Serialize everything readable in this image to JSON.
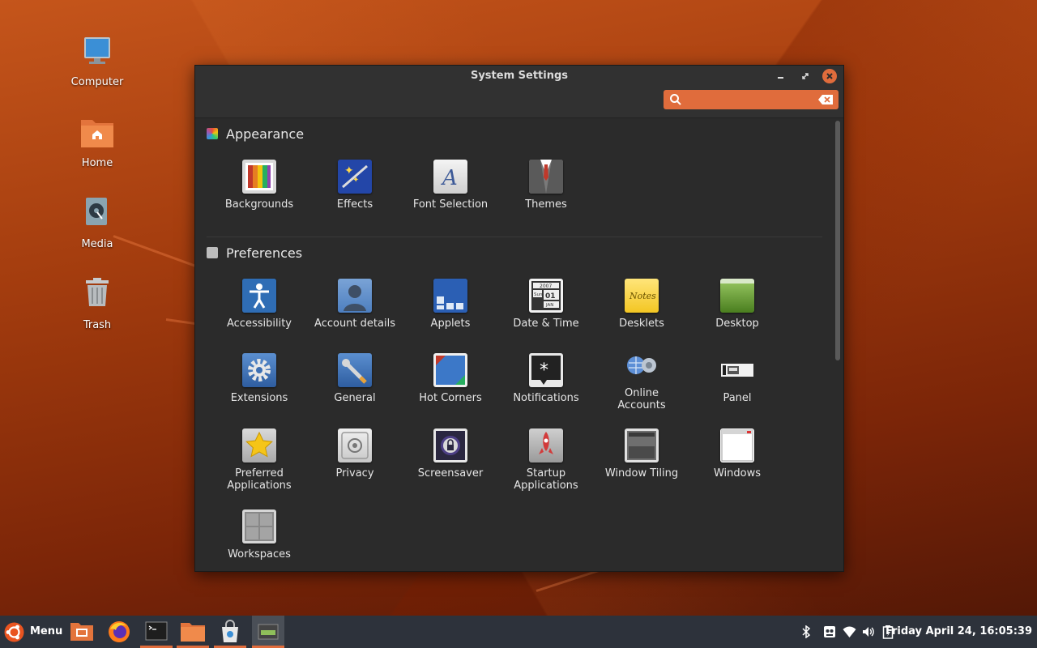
{
  "desktop": {
    "icons": [
      {
        "label": "Computer"
      },
      {
        "label": "Home"
      },
      {
        "label": "Media"
      },
      {
        "label": "Trash"
      }
    ]
  },
  "window": {
    "title": "System Settings",
    "search": {
      "value": "",
      "placeholder": ""
    },
    "sections": [
      {
        "title": "Appearance",
        "items": [
          {
            "label": "Backgrounds",
            "icon": "backgrounds-icon"
          },
          {
            "label": "Effects",
            "icon": "effects-icon"
          },
          {
            "label": "Font Selection",
            "icon": "font-icon"
          },
          {
            "label": "Themes",
            "icon": "themes-icon"
          }
        ]
      },
      {
        "title": "Preferences",
        "items": [
          {
            "label": "Accessibility",
            "icon": "accessibility-icon"
          },
          {
            "label": "Account details",
            "icon": "account-icon"
          },
          {
            "label": "Applets",
            "icon": "applets-icon"
          },
          {
            "label": "Date & Time",
            "icon": "calendar-icon"
          },
          {
            "label": "Desklets",
            "icon": "notes-icon"
          },
          {
            "label": "Desktop",
            "icon": "desktop-icon"
          },
          {
            "label": "Extensions",
            "icon": "gear-icon"
          },
          {
            "label": "General",
            "icon": "wrench-icon"
          },
          {
            "label": "Hot Corners",
            "icon": "hot-corners-icon"
          },
          {
            "label": "Notifications",
            "icon": "notification-icon"
          },
          {
            "label": "Online Accounts",
            "icon": "online-accounts-icon"
          },
          {
            "label": "Panel",
            "icon": "panel-icon"
          },
          {
            "label": "Preferred Applications",
            "icon": "star-icon"
          },
          {
            "label": "Privacy",
            "icon": "safe-icon"
          },
          {
            "label": "Screensaver",
            "icon": "lock-icon"
          },
          {
            "label": "Startup Applications",
            "icon": "rocket-icon"
          },
          {
            "label": "Window Tiling",
            "icon": "tiling-icon"
          },
          {
            "label": "Windows",
            "icon": "window-icon"
          },
          {
            "label": "Workspaces",
            "icon": "workspaces-icon"
          }
        ]
      }
    ],
    "calendar_icon": {
      "year": "2007",
      "day": "Sun",
      "date": "01",
      "month": "JAN"
    },
    "desklets_icon_text": "Notes"
  },
  "taskbar": {
    "menu_label": "Menu",
    "clock": "Friday April 24, 16:05:39"
  },
  "colors": {
    "accent": "#e06c3c",
    "window_bg": "#2b2b2b",
    "panel_bg": "#2d323b"
  }
}
